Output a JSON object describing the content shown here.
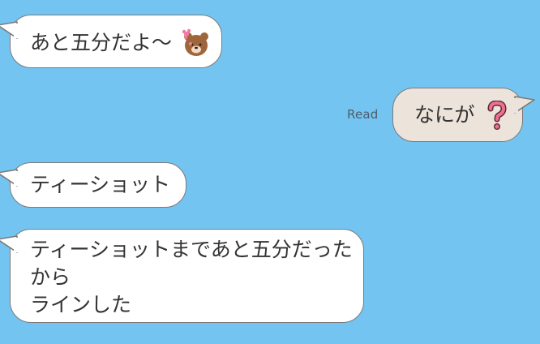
{
  "messages": [
    {
      "id": "m1",
      "side": "in",
      "text": "あと五分だよ〜",
      "emoji": "bear-sticker-icon"
    },
    {
      "id": "m2",
      "side": "out",
      "text": "なにが",
      "emoji": "question-mark-icon",
      "status": "Read"
    },
    {
      "id": "m3",
      "side": "in",
      "text": "ティーショット"
    },
    {
      "id": "m4",
      "side": "in",
      "lines": [
        "ティーショットまであと五分だった",
        "から",
        "ラインした"
      ]
    }
  ],
  "colors": {
    "background": "#74c4f1",
    "incoming_bubble": "#ffffff",
    "outgoing_bubble": "#ece3da",
    "bubble_border": "#7a7a7a",
    "text": "#333333"
  }
}
